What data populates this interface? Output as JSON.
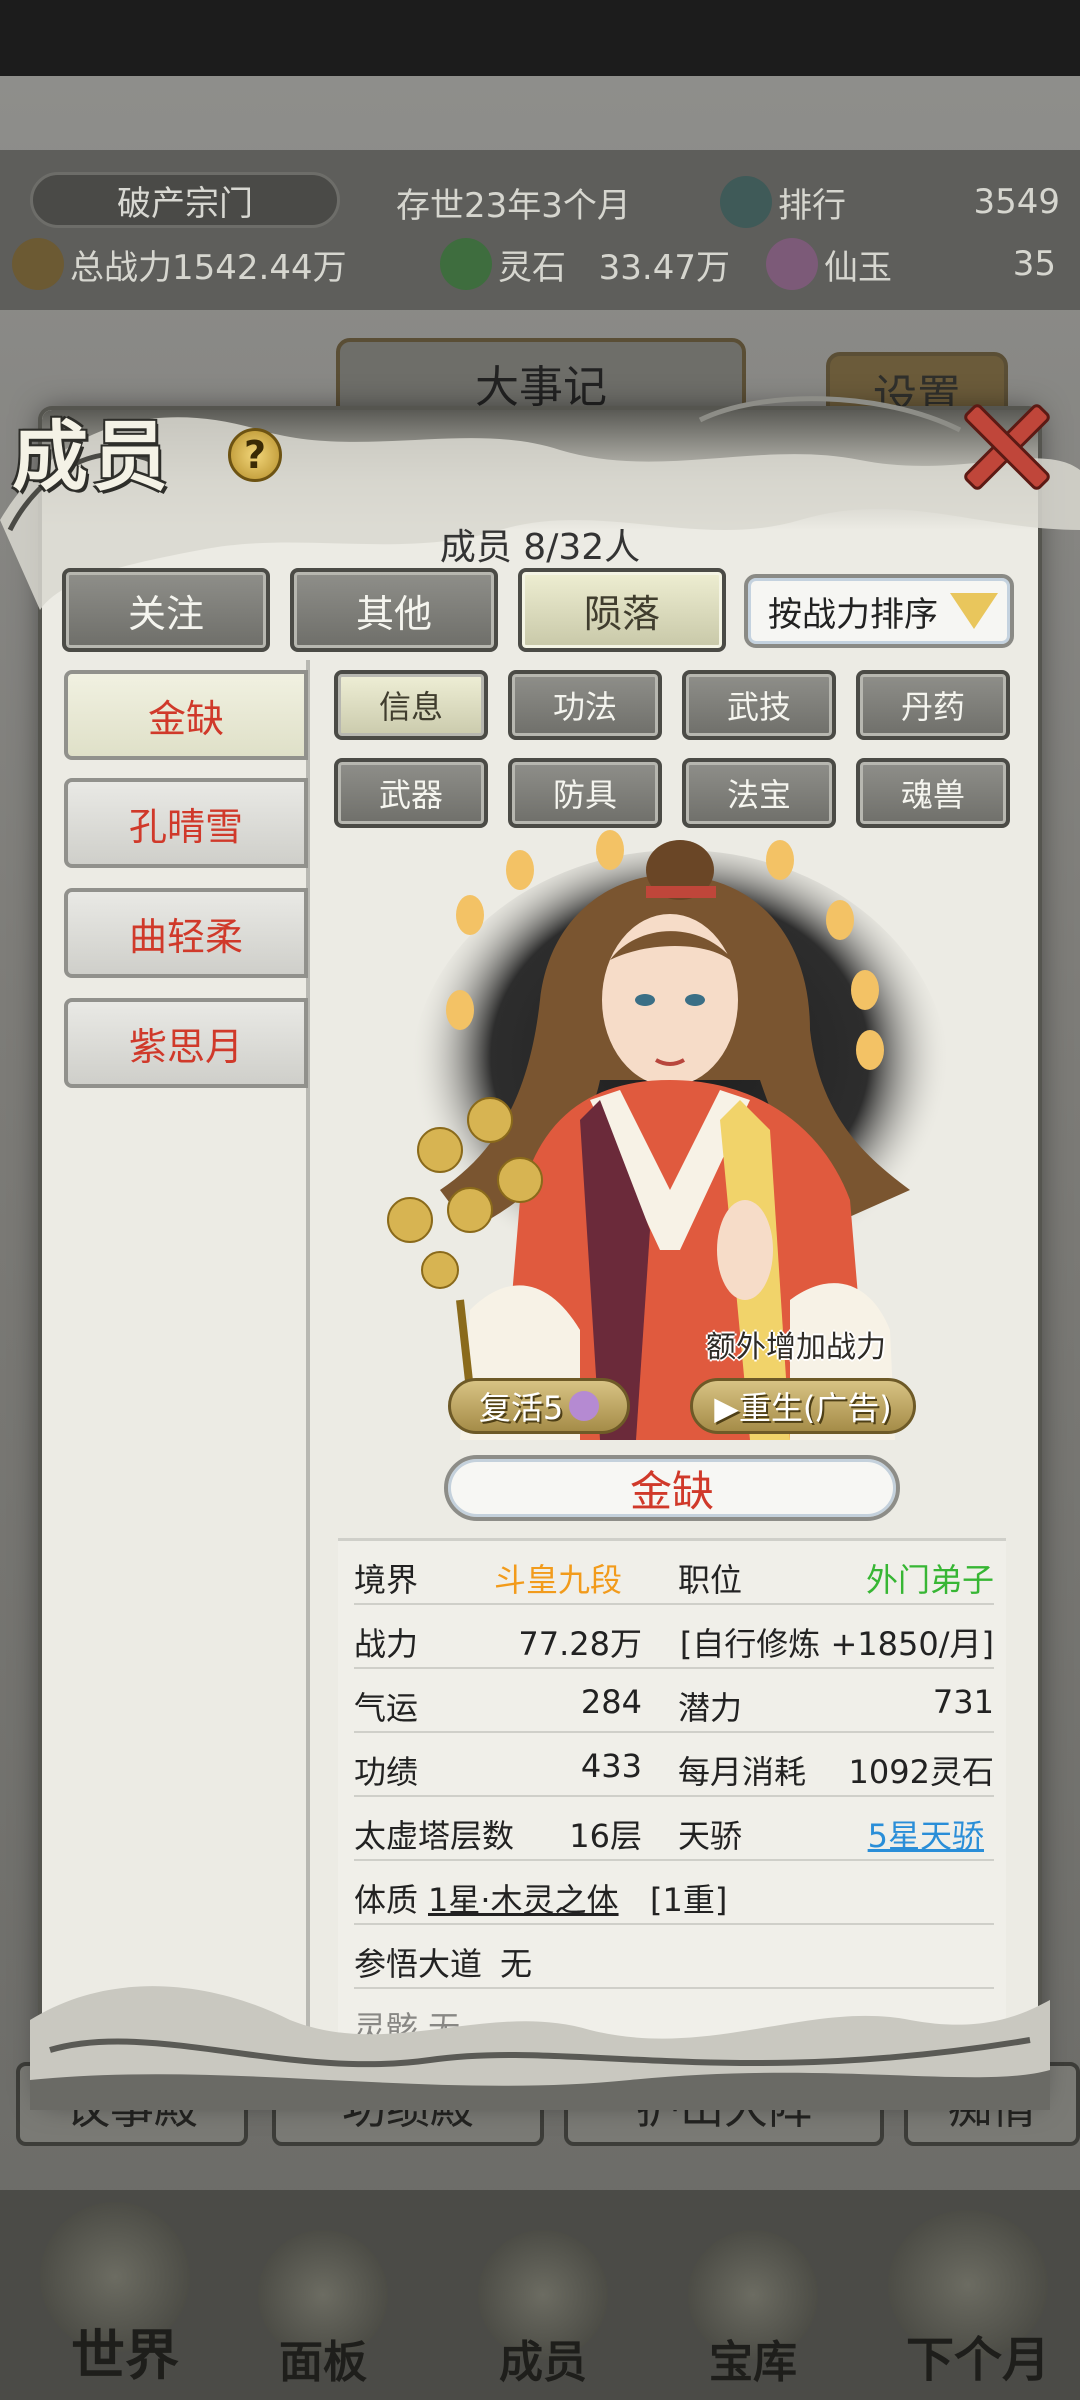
{
  "background": {
    "sect_name": "破产宗门",
    "time": "存世23年3个月",
    "rank_label": "排行",
    "rank_value": "3549",
    "total_power": "总战力1542.44万",
    "spirit_stone_label": "灵石",
    "spirit_stone_value": "33.47万",
    "jade_label": "仙玉",
    "jade_value": "35",
    "events_title": "大事记",
    "settings_label": "设置",
    "halls": [
      "议事殿",
      "功绩殿",
      "护山大阵",
      "痴情"
    ],
    "nav": [
      "世界",
      "面板",
      "成员",
      "宝库",
      "下个月"
    ]
  },
  "modal": {
    "title": "成员",
    "member_count": "成员  8/32人",
    "tabs": [
      "关注",
      "其他",
      "陨落"
    ],
    "active_tab": 2,
    "sort_label": "按战力排序",
    "members": [
      "金缺",
      "孔晴雪",
      "曲轻柔",
      "紫思月"
    ],
    "active_member": 0,
    "sub_tabs": [
      "信息",
      "功法",
      "武技",
      "丹药",
      "武器",
      "防具",
      "法宝",
      "魂兽"
    ],
    "active_sub_tab": 0,
    "portrait": {
      "extra_power": "额外增加战力",
      "revive": "复活5",
      "rebirth": "▶重生(广告)"
    },
    "name": "金缺",
    "info": {
      "realm_label": "境界",
      "realm_value": "斗皇九段",
      "position_label": "职位",
      "position_value": "外门弟子",
      "power_label": "战力",
      "power_value": "77.28万",
      "cultivation": "[自行修炼 +1850/月]",
      "luck_label": "气运",
      "luck_value": "284",
      "potential_label": "潜力",
      "potential_value": "731",
      "merit_label": "功绩",
      "merit_value": "433",
      "monthly_cost_label": "每月消耗",
      "monthly_cost_value": "1092灵石",
      "tower_label": "太虚塔层数",
      "tower_value": "16层",
      "talent_label": "天骄",
      "talent_value": "5星天骄",
      "physique_label": "体质",
      "physique_value": "1星·木灵之体",
      "physique_level": "[1重]",
      "dao_label": "参悟大道",
      "dao_value": "无",
      "partial_label": "灵骸 无"
    }
  },
  "colors": {
    "accent_red": "#d0392a",
    "orange": "#f29b1b",
    "green": "#37b634",
    "blue": "#2a8ed8"
  }
}
